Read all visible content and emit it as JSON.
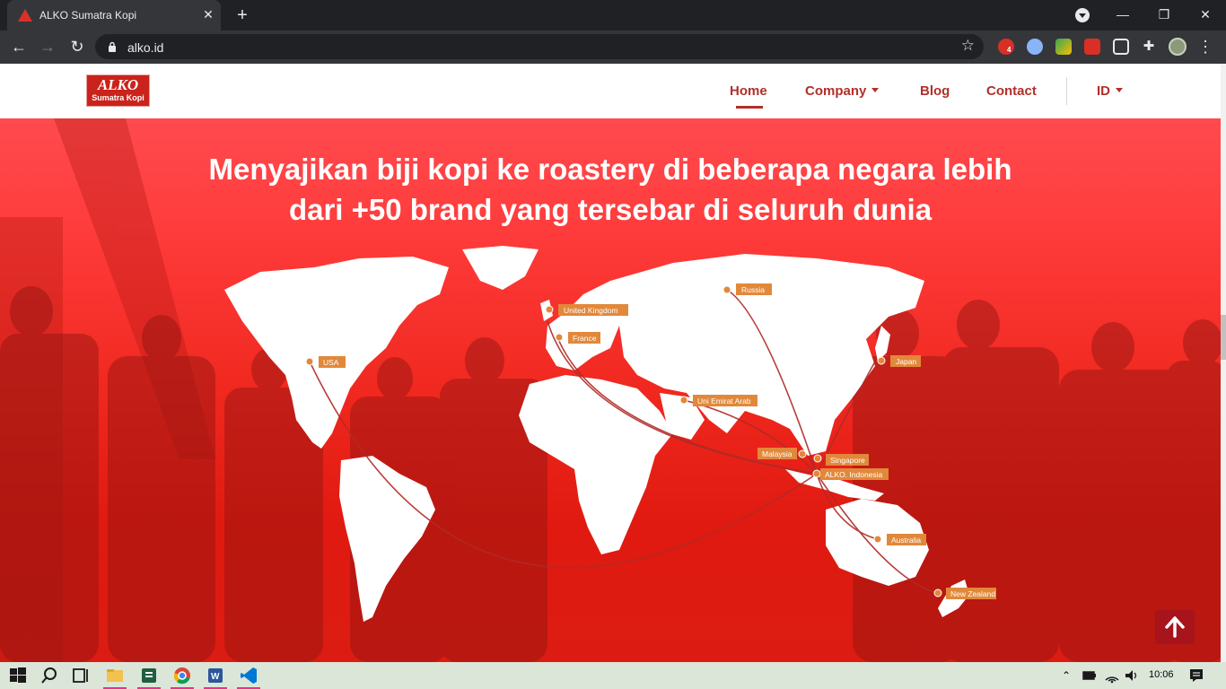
{
  "browser": {
    "tab_title": "ALKO Sumatra Kopi",
    "url": "alko.id",
    "extension_badge": "4"
  },
  "site": {
    "logo_top": "ALKO",
    "logo_bottom": "Sumatra Kopi",
    "menu": {
      "home": "Home",
      "company": "Company",
      "blog": "Blog",
      "contact": "Contact",
      "language": "ID"
    }
  },
  "hero": {
    "title_line1": "Menyajikan biji kopi ke roastery di beberapa negara lebih",
    "title_line2": "dari +50 brand yang tersebar di seluruh dunia"
  },
  "map_labels": {
    "russia": "Russia",
    "united_kingdom": "United Kingdom",
    "france": "France",
    "usa": "USA",
    "japan": "Japan",
    "uae": "Uni Emirat Arab",
    "malaysia": "Malaysia",
    "singapore": "Singapore",
    "indonesia": "ALKO. Indonesia",
    "australia": "Australia",
    "new_zealand": "New Zealand"
  },
  "colors": {
    "brand_red": "#b0302a",
    "hero_red": "#e01a10",
    "label_orange": "#e2883a"
  },
  "taskbar": {
    "clock": "10:06"
  }
}
